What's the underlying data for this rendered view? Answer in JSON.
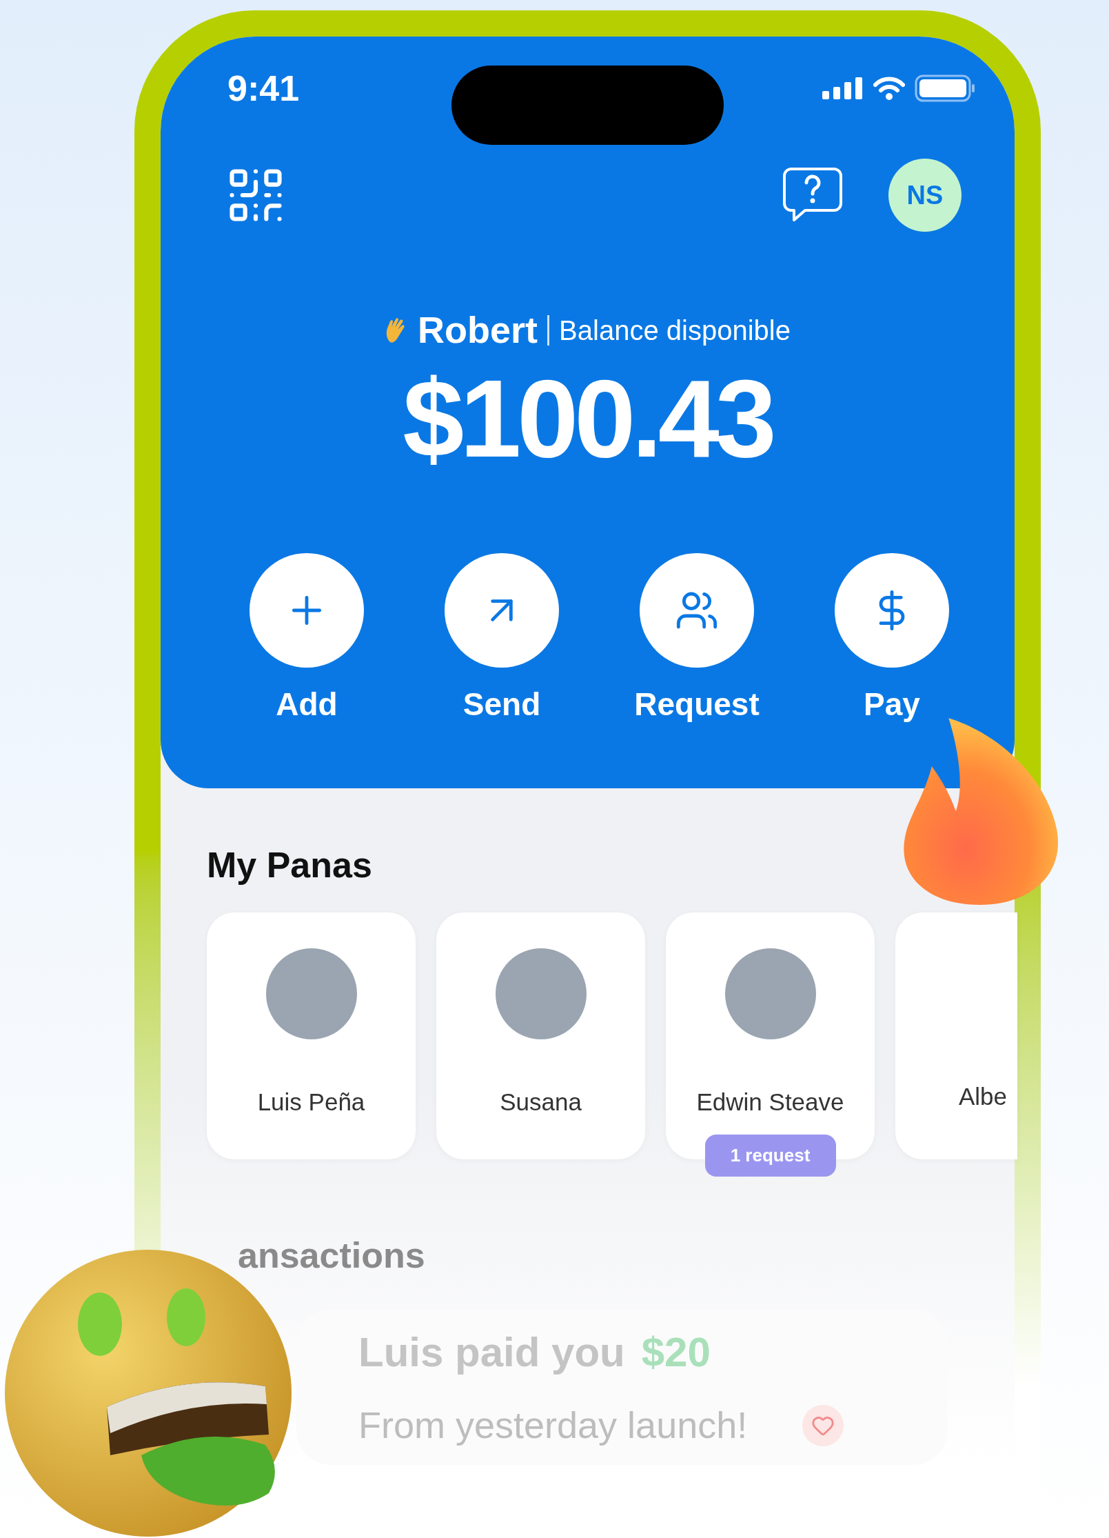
{
  "status_bar": {
    "time": "9:41"
  },
  "header": {
    "avatar_initials": "NS"
  },
  "greeting": {
    "name": "Robert",
    "label": "Balance disponible"
  },
  "balance": "$100.43",
  "actions": [
    {
      "label": "Add",
      "kind": "add"
    },
    {
      "label": "Send",
      "kind": "send"
    },
    {
      "label": "Request",
      "kind": "request"
    },
    {
      "label": "Pay",
      "kind": "pay"
    }
  ],
  "panas": {
    "title": "My Panas",
    "contacts": [
      {
        "name": "Luis Peña",
        "kind": "full"
      },
      {
        "name": "Susana",
        "kind": "full"
      },
      {
        "name": "Edwin Steave",
        "kind": "full",
        "badge": "1 request"
      },
      {
        "name": "Albe",
        "kind": "partial"
      }
    ]
  },
  "transactions": {
    "title": "ansactions",
    "items": [
      {
        "title": "Luis paid you",
        "amount": "$20",
        "note": "From yesterday launch!"
      }
    ]
  }
}
